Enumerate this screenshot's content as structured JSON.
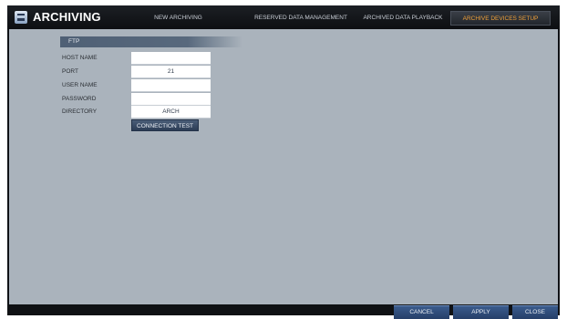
{
  "app": {
    "title": "ARCHIVING",
    "icon": "archive-icon"
  },
  "tabs": [
    {
      "label": "NEW ARCHIVING",
      "active": false
    },
    {
      "label": "RESERVED DATA MANAGEMENT",
      "active": false
    },
    {
      "label": "ARCHIVED DATA PLAYBACK",
      "active": false
    },
    {
      "label": "ARCHIVE DEVICES SETUP",
      "active": true
    }
  ],
  "section": {
    "title": "FTP"
  },
  "fields": {
    "host_name": {
      "label": "HOST NAME",
      "value": ""
    },
    "port": {
      "label": "PORT",
      "value": "21"
    },
    "user_name": {
      "label": "USER NAME",
      "value": ""
    },
    "password": {
      "label": "PASSWORD",
      "value": ""
    },
    "directory": {
      "label": "DIRECTORY",
      "value": "ARCH"
    }
  },
  "buttons": {
    "connection_test": "CONNECTION TEST",
    "cancel": "CANCEL",
    "apply": "APPLY",
    "close": "CLOSE"
  },
  "colors": {
    "active_tab": "#f2a23a",
    "content_bg": "#aab3bc",
    "button_blue": "#2c3c55"
  }
}
